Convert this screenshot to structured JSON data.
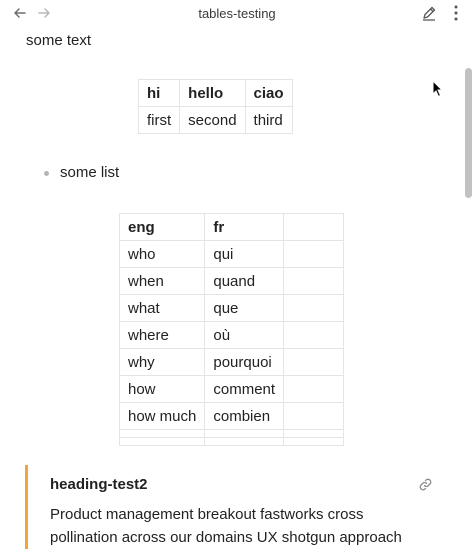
{
  "window": {
    "title": "tables-testing"
  },
  "icons": {
    "back": "arrow-left-icon",
    "forward": "arrow-right-icon",
    "edit": "pencil-icon",
    "more": "more-vertical-icon",
    "link": "link-icon"
  },
  "content": {
    "paragraph": "some text",
    "table1": {
      "headers": [
        "hi",
        "hello",
        "ciao"
      ],
      "rows": [
        [
          "first",
          "second",
          "third"
        ]
      ]
    },
    "list": [
      "some list"
    ],
    "table2": {
      "headers": [
        "eng",
        "fr",
        ""
      ],
      "rows": [
        [
          "who",
          "qui",
          ""
        ],
        [
          "when",
          "quand",
          ""
        ],
        [
          "what",
          "que",
          ""
        ],
        [
          "where",
          "où",
          ""
        ],
        [
          "why",
          "pourquoi",
          ""
        ],
        [
          "how",
          "comment",
          ""
        ],
        [
          "how much",
          "combien",
          ""
        ],
        [
          "",
          "",
          ""
        ],
        [
          "",
          "",
          ""
        ]
      ]
    },
    "callout": {
      "title": "heading-test2",
      "body": "Product management breakout fastworks cross pollination across our domains UX shotgun approach"
    }
  },
  "colors": {
    "accent": "#f4a23a",
    "border": "#e4e4e4",
    "scrollbar": "#c1c1c1"
  }
}
